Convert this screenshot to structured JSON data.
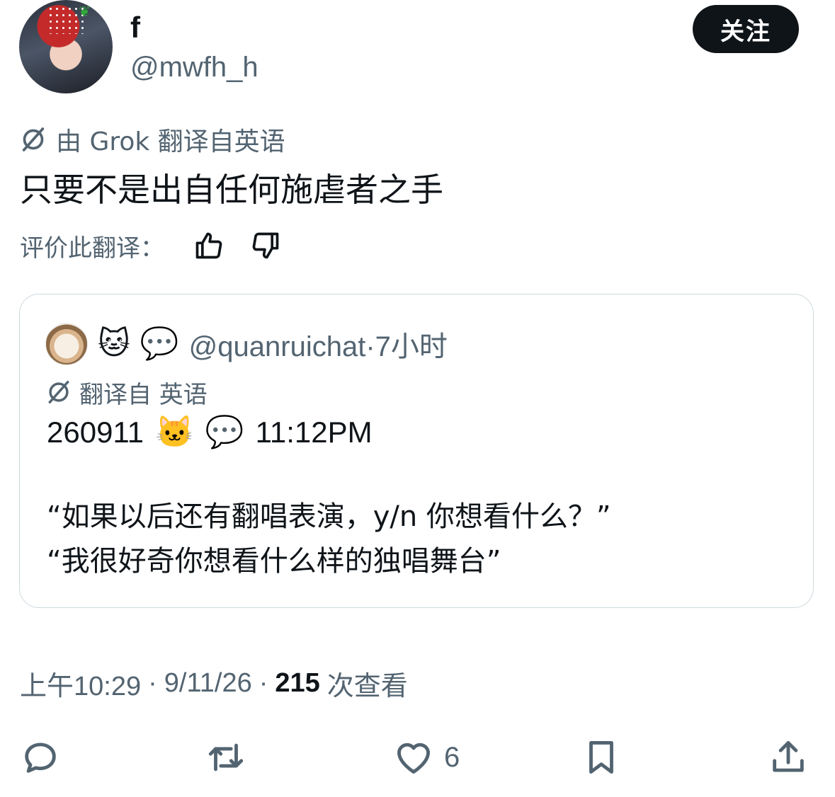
{
  "author": {
    "display_name": "f",
    "handle": "@mwfh_h",
    "follow_label": "关注"
  },
  "translation_notice": "由 Grok 翻译自英语",
  "post_text": "只要不是出自任何施虐者之手",
  "rate_label": "评价此翻译：",
  "quote": {
    "emoji_1": "🐱",
    "emoji_2": "💬",
    "handle": "@quanruichat",
    "separator": "·",
    "time": "7小时",
    "translation_notice": "翻译自 英语",
    "line1_prefix": "260911",
    "line1_emoji_1": "🐱",
    "line1_emoji_2": "💬",
    "line1_suffix": "11:12PM",
    "line2": "“如果以后还有翻唱表演，y/n 你想看什么？”",
    "line3": "“我很好奇你想看什么样的独唱舞台”"
  },
  "meta": {
    "time": "上午10:29",
    "dot1": "·",
    "date": "9/11/26",
    "dot2": "·",
    "views_count": "215",
    "views_label": "次查看"
  },
  "actions": {
    "like_count": "6"
  },
  "icons": [
    "translate-icon",
    "thumbs-up-icon",
    "thumbs-down-icon",
    "reply-icon",
    "retweet-icon",
    "heart-icon",
    "bookmark-icon",
    "share-icon"
  ]
}
